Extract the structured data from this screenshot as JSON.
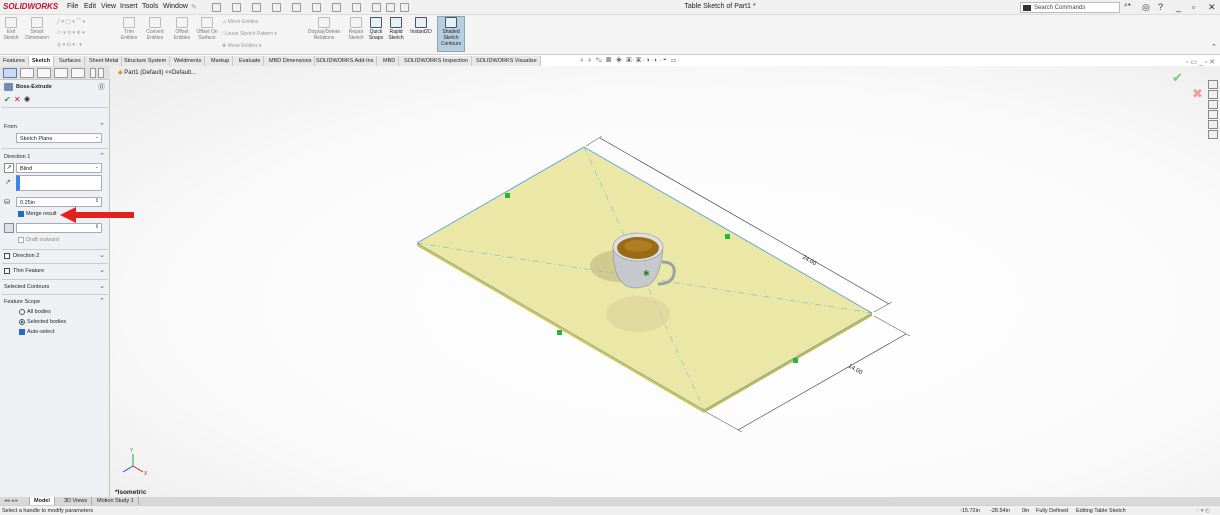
{
  "app": {
    "logo": "SOLIDWORKS",
    "window_title": "Table Sketch of Part1 *"
  },
  "menu": [
    "File",
    "Edit",
    "View",
    "Insert",
    "Tools",
    "Window"
  ],
  "search": {
    "placeholder": "Search Commands"
  },
  "ribbon": {
    "exit_sketch": "Exit Sketch",
    "smart_dimension": "Smart Dimension",
    "trim_entities": "Trim Entities",
    "convert_entities": "Convert Entities",
    "offset_entities": "Offset Entities",
    "offset_on_surface": "Offset On Surface",
    "mirror_entities": "Mirror Entities",
    "linear_sketch_pattern": "Linear Sketch Pattern",
    "move_entities": "Move Entities",
    "display_delete_relations": "Display/Delete Relations",
    "repair_sketch": "Repair Sketch",
    "quick_snaps": "Quick Snaps",
    "rapid_sketch": "Rapid Sketch",
    "instant2d": "Instant2D",
    "shaded_sketch_contours": "Shaded Sketch Contours"
  },
  "tabs": [
    "Features",
    "Sketch",
    "Surfaces",
    "Sheet Metal",
    "Structure System",
    "Weldments",
    "Markup",
    "Evaluate",
    "MBD Dimensions",
    "SOLIDWORKS Add-Ins",
    "MBD",
    "SOLIDWORKS Inspection",
    "SOLIDWORKS Visualize"
  ],
  "active_tab": "Sketch",
  "property_manager": {
    "title": "Boss-Extrude",
    "from_label": "From",
    "from_value": "Sketch Plane",
    "direction1_label": "Direction 1",
    "end_condition": "Blind",
    "depth": "0.25in",
    "merge_result": "Merge result",
    "merge_checked": true,
    "draft_outward": "Draft outward",
    "direction2": "Direction 2",
    "thin_feature": "Thin Feature",
    "selected_contours": "Selected Contours",
    "feature_scope": "Feature Scope",
    "all_bodies": "All bodies",
    "selected_bodies": "Selected bodies",
    "auto_select": "Auto-select"
  },
  "tree": {
    "item": "Part1 (Default) <<Default..."
  },
  "model": {
    "dim_length": "24.00",
    "dim_width": "14.00",
    "view_label": "*Isometric"
  },
  "bottom_tabs": [
    "Model",
    "3D Views",
    "Motion Study 1"
  ],
  "status": {
    "hint": "Select a handle to modify parameters",
    "x": "-15.72in",
    "y": "-28.54in",
    "z": "0in",
    "defined": "Fully Defined",
    "mode": "Editing Table Sketch"
  },
  "colors": {
    "plane_fill": "#ebe7a6",
    "edge_blue": "#5aa7e6",
    "arrow_red": "#e0211d",
    "accent": "#1f6fc0"
  }
}
